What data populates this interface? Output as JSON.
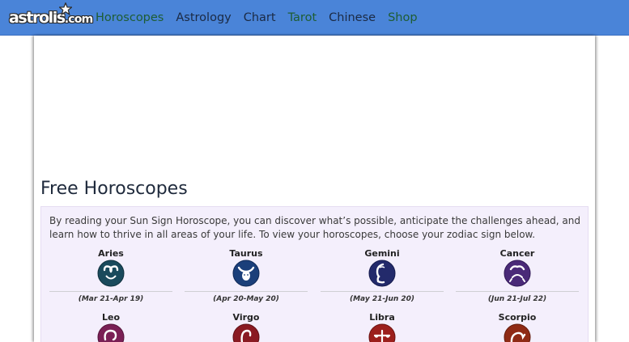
{
  "brand": {
    "logo_text": "astrolis",
    "logo_domain": ".com"
  },
  "nav": {
    "items": [
      {
        "label": "Horoscopes",
        "tone": "green"
      },
      {
        "label": "Astrology",
        "tone": "dark"
      },
      {
        "label": "Chart",
        "tone": "dark"
      },
      {
        "label": "Tarot",
        "tone": "green"
      },
      {
        "label": "Chinese",
        "tone": "dark"
      },
      {
        "label": "Shop",
        "tone": "green"
      }
    ]
  },
  "main": {
    "title": "Free Horoscopes",
    "intro": "By reading your Sun Sign Horoscope, you can discover what’s possible, anticipate the challenges ahead, and learn how to thrive in all areas of your life. To view your horoscopes, choose your zodiac sign below.",
    "signs": [
      {
        "name": "Aries",
        "dates": "(Mar 21-Apr 19)",
        "icon": "ram-icon",
        "color": "#1a4a5c"
      },
      {
        "name": "Taurus",
        "dates": "(Apr 20-May 20)",
        "icon": "bull-icon",
        "color": "#1b3f7a"
      },
      {
        "name": "Gemini",
        "dates": "(May 21-Jun 20)",
        "icon": "twins-icon",
        "color": "#232a6b"
      },
      {
        "name": "Cancer",
        "dates": "(Jun 21-Jul 22)",
        "icon": "crab-icon",
        "color": "#4a2a78"
      },
      {
        "name": "Leo",
        "dates": "",
        "icon": "lion-icon",
        "color": "#7a1f55"
      },
      {
        "name": "Virgo",
        "dates": "",
        "icon": "virgin-icon",
        "color": "#8a1a22"
      },
      {
        "name": "Libra",
        "dates": "",
        "icon": "scales-icon",
        "color": "#9c1f1c"
      },
      {
        "name": "Scorpio",
        "dates": "",
        "icon": "scorpion-icon",
        "color": "#8f2a14"
      }
    ]
  },
  "colors": {
    "navbar": "#4a84d8",
    "panel": "#f4effc",
    "nav_green": "#1e5d33",
    "nav_dark": "#1b2a44"
  }
}
